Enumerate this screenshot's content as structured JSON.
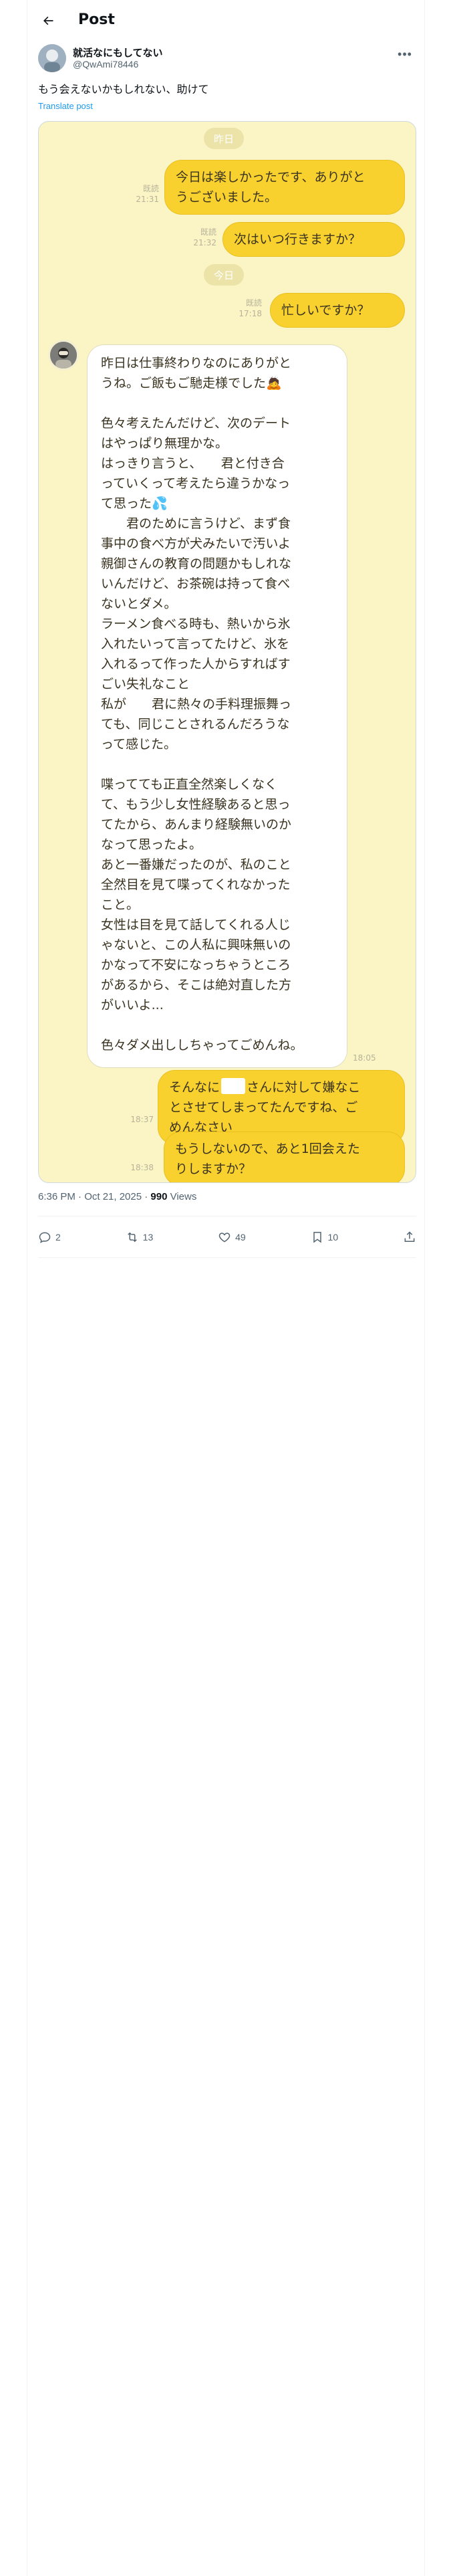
{
  "header": {
    "title": "Post"
  },
  "author": {
    "name": "就活なにもしてない",
    "handle": "@QwAmi78446"
  },
  "post": {
    "text": "もう会えないかもしれない、助けて",
    "translate_label": "Translate post"
  },
  "chat": {
    "day_chip_1": "昨日",
    "day_chip_2": "今日",
    "msg1": {
      "lines": [
        "今日は楽しかったです、ありがと",
        "うございました。"
      ],
      "read": "既読",
      "time": "21:31"
    },
    "msg2": {
      "lines": [
        "次はいつ行きますか？"
      ],
      "read": "既読",
      "time": "21:32"
    },
    "msg3": {
      "lines": [
        "忙しいですか？"
      ],
      "read": "既読",
      "time": "17:18"
    },
    "reply": {
      "lines": [
        "昨日は仕事終わりなのにありがと",
        "うね。ご飯もご馳走様でした🙇",
        "",
        "色々考えたんだけど、次のデート",
        "はやっぱり無理かな。",
        "はっきり言うと、　　君と付き合",
        "っていくって考えたら違うかなっ",
        "て思った💦",
        "　　君のために言うけど、まず食",
        "事中の食べ方が犬みたいで汚いよ",
        "親御さんの教育の問題かもしれな",
        "いんだけど、お茶碗は持って食べ",
        "ないとダメ。",
        "ラーメン食べる時も、熱いから氷",
        "入れたいって言ってたけど、氷を",
        "入れるって作った人からすればす",
        "ごい失礼なこと",
        "私が　　君に熱々の手料理振舞っ",
        "ても、同じことされるんだろうな",
        "って感じた。",
        "",
        "喋ってても正直全然楽しくなく",
        "て、もう少し女性経験あると思っ",
        "てたから、あんまり経験無いのか",
        "なって思ったよ。",
        "あと一番嫌だったのが、私のこと",
        "全然目を見て喋ってくれなかった",
        "こと。",
        "女性は目を見て話してくれる人じ",
        "ゃないと、この人私に興味無いの",
        "かなって不安になっちゃうところ",
        "があるから、そこは絶対直した方",
        "がいいよ...",
        "",
        "色々ダメ出ししちゃってごめんね。"
      ],
      "time": "18:05"
    },
    "msg4": {
      "lines_pre": "そんなに",
      "lines_post": "さんに対して嫌なこ",
      "line2": "とさせてしまってたんですね、ご",
      "line3": "めんなさい",
      "time": "18:37"
    },
    "msg5": {
      "lines": [
        "もうしないので、あと1回会えた",
        "りしますか？"
      ],
      "time": "18:38"
    }
  },
  "meta": {
    "time": "6:36 PM · Oct 21, 2025 · ",
    "views_count": "990",
    "views_label": " Views"
  },
  "actions": {
    "replies": "2",
    "reposts": "13",
    "likes": "49",
    "bookmarks": "10"
  },
  "colors": {
    "chat_bg": "#fbf5c5",
    "outgoing_bubble": "#f8d12f",
    "link": "#1d9bf0"
  }
}
